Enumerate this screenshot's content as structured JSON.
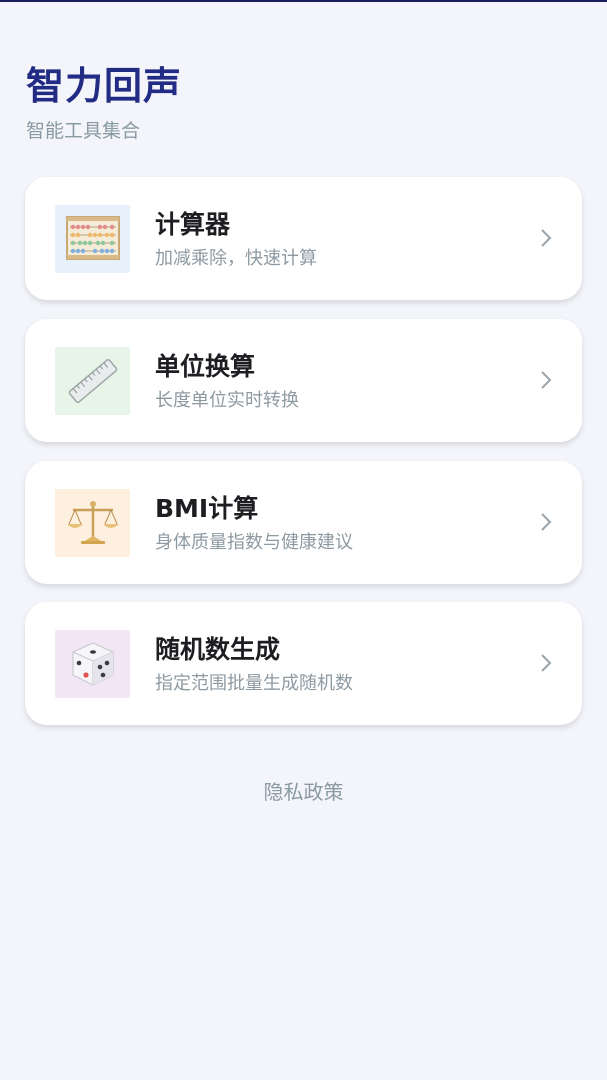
{
  "header": {
    "title": "智力回声",
    "subtitle": "智能工具集合"
  },
  "cards": [
    {
      "title": "计算器",
      "desc": "加减乘除，快速计算",
      "icon": "abacus-icon",
      "icon_bg": "#e6f1fb"
    },
    {
      "title": "单位换算",
      "desc": "长度单位实时转换",
      "icon": "ruler-icon",
      "icon_bg": "#e7f5e8"
    },
    {
      "title": "BMI计算",
      "desc": "身体质量指数与健康建议",
      "icon": "scale-balance-icon",
      "icon_bg": "#fdf0df"
    },
    {
      "title": "随机数生成",
      "desc": "指定范围批量生成随机数",
      "icon": "dice-icon",
      "icon_bg": "#f3e6f4"
    }
  ],
  "footer": {
    "privacy_label": "隐私政策"
  },
  "colors": {
    "background": "#f3f5fa",
    "title": "#232c85",
    "muted_text": "#8a9aa3",
    "card": "#ffffff"
  }
}
